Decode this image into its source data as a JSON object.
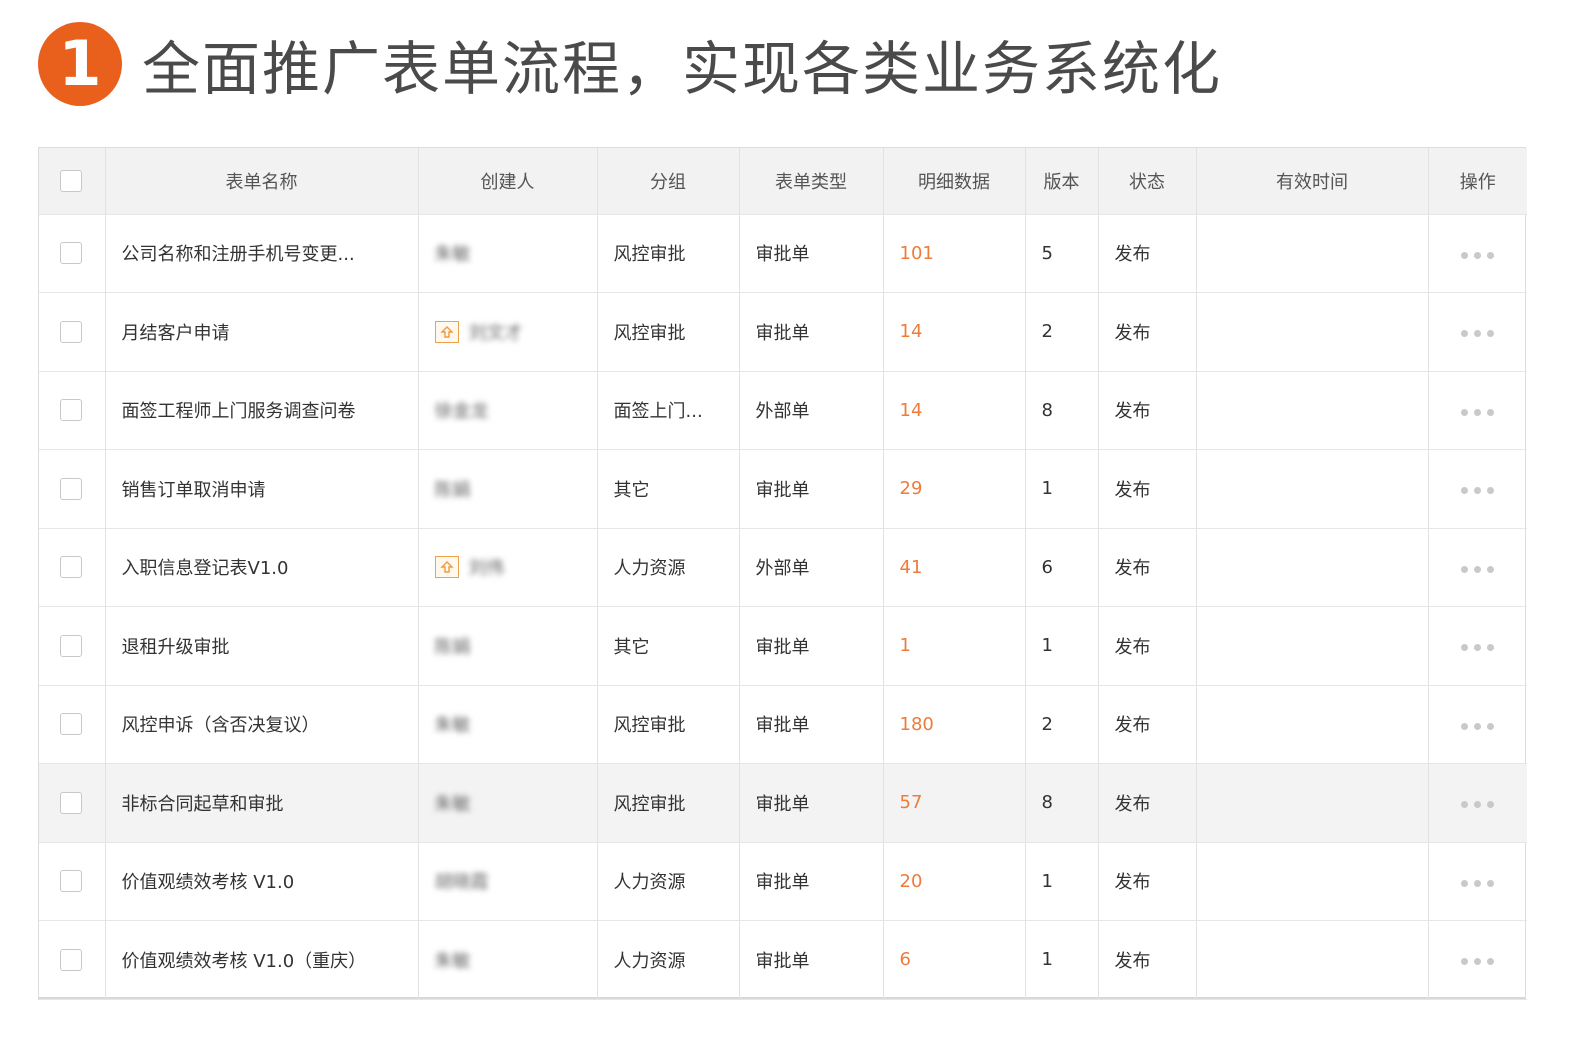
{
  "header": {
    "step_number": "1",
    "title": "全面推广表单流程，实现各类业务系统化"
  },
  "table": {
    "columns": [
      "表单名称",
      "创建人",
      "分组",
      "表单类型",
      "明细数据",
      "版本",
      "状态",
      "有效时间",
      "操作"
    ],
    "rows": [
      {
        "name": "公司名称和注册手机号变更...",
        "creator": "朱敏",
        "group": "风控审批",
        "type": "审批单",
        "details": "101",
        "version": "5",
        "status": "发布",
        "valid": ""
      },
      {
        "name": "月结客户申请",
        "creator": "刘文才",
        "group": "风控审批",
        "type": "审批单",
        "details": "14",
        "version": "2",
        "status": "发布",
        "valid": ""
      },
      {
        "name": "面签工程师上门服务调查问卷",
        "creator": "徐金龙",
        "group": "面签上门...",
        "type": "外部单",
        "details": "14",
        "version": "8",
        "status": "发布",
        "valid": ""
      },
      {
        "name": "销售订单取消申请",
        "creator": "陈娟",
        "group": "其它",
        "type": "审批单",
        "details": "29",
        "version": "1",
        "status": "发布",
        "valid": ""
      },
      {
        "name": "入职信息登记表V1.0",
        "creator": "刘伟",
        "group": "人力资源",
        "type": "外部单",
        "details": "41",
        "version": "6",
        "status": "发布",
        "valid": ""
      },
      {
        "name": "退租升级审批",
        "creator": "陈娟",
        "group": "其它",
        "type": "审批单",
        "details": "1",
        "version": "1",
        "status": "发布",
        "valid": ""
      },
      {
        "name": "风控申诉（含否决复议）",
        "creator": "朱敏",
        "group": "风控审批",
        "type": "审批单",
        "details": "180",
        "version": "2",
        "status": "发布",
        "valid": ""
      },
      {
        "name": "非标合同起草和审批",
        "creator": "朱敏",
        "group": "风控审批",
        "type": "审批单",
        "details": "57",
        "version": "8",
        "status": "发布",
        "valid": ""
      },
      {
        "name": "价值观绩效考核 V1.0",
        "creator": "胡晓霞",
        "group": "人力资源",
        "type": "审批单",
        "details": "20",
        "version": "1",
        "status": "发布",
        "valid": ""
      },
      {
        "name": "价值观绩效考核 V1.0（重庆）",
        "creator": "朱敏",
        "group": "人力资源",
        "type": "审批单",
        "details": "6",
        "version": "1",
        "status": "发布",
        "valid": ""
      }
    ]
  }
}
